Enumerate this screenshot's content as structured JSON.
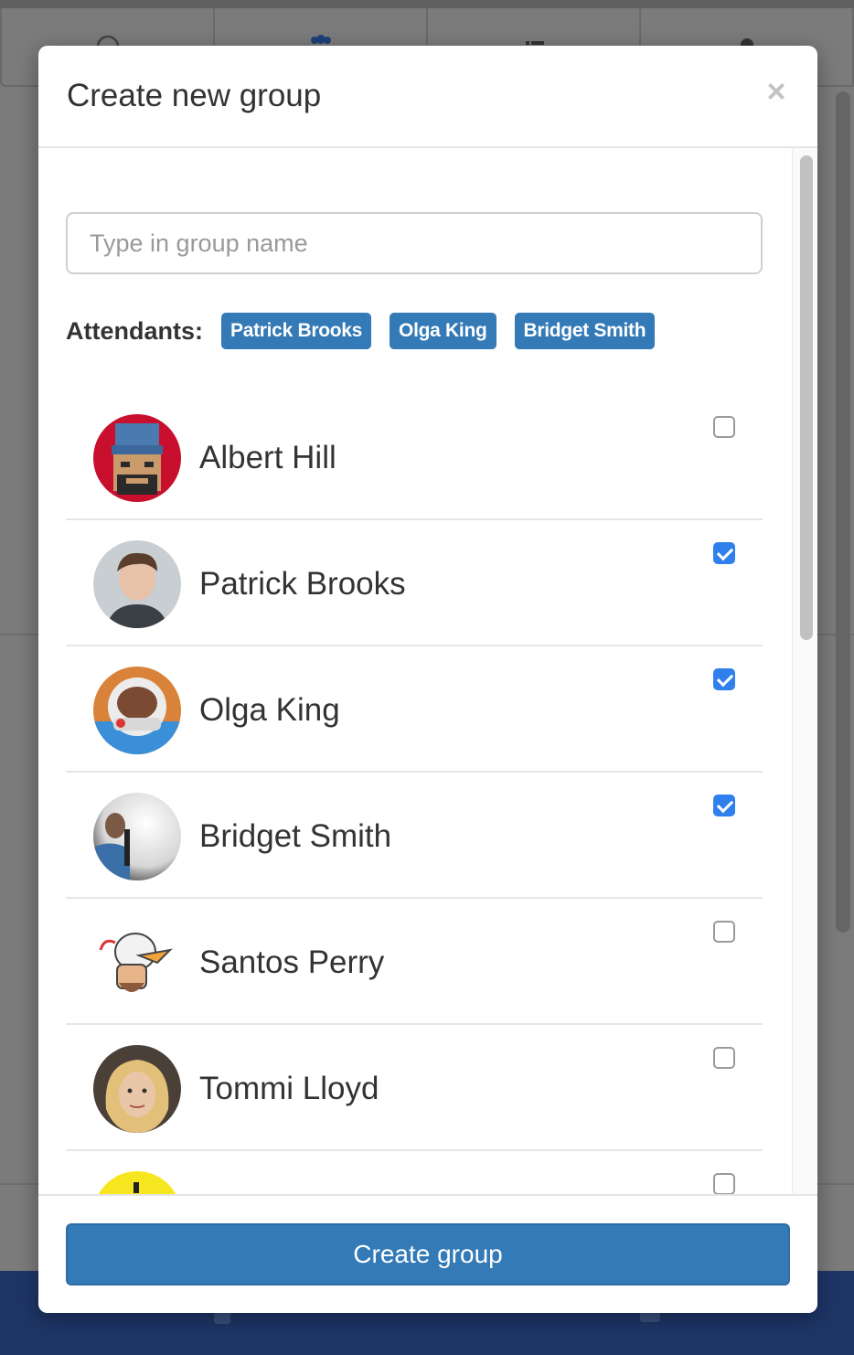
{
  "dialog": {
    "title": "Create new group",
    "close_label": "×",
    "group_name_placeholder": "Type in group name",
    "attendants_label": "Attendants:",
    "attendants": [
      "Patrick Brooks",
      "Olga King",
      "Bridget Smith"
    ],
    "users": [
      {
        "name": "Albert Hill",
        "checked": false,
        "avatar": "avatar-pixel-man"
      },
      {
        "name": "Patrick Brooks",
        "checked": true,
        "avatar": "avatar-photo-man"
      },
      {
        "name": "Olga King",
        "checked": true,
        "avatar": "avatar-astronaut"
      },
      {
        "name": "Bridget Smith",
        "checked": true,
        "avatar": "avatar-photo-sphere"
      },
      {
        "name": "Santos Perry",
        "checked": false,
        "avatar": "avatar-duck-cartoon"
      },
      {
        "name": "Tommi Lloyd",
        "checked": false,
        "avatar": "avatar-photo-woman"
      },
      {
        "name": "",
        "checked": false,
        "avatar": "avatar-yellow-smiley"
      }
    ],
    "create_button": "Create group"
  },
  "colors": {
    "primary": "#337ab7",
    "checkbox_checked": "#2f80ed",
    "footer_bar": "#1e3566"
  }
}
